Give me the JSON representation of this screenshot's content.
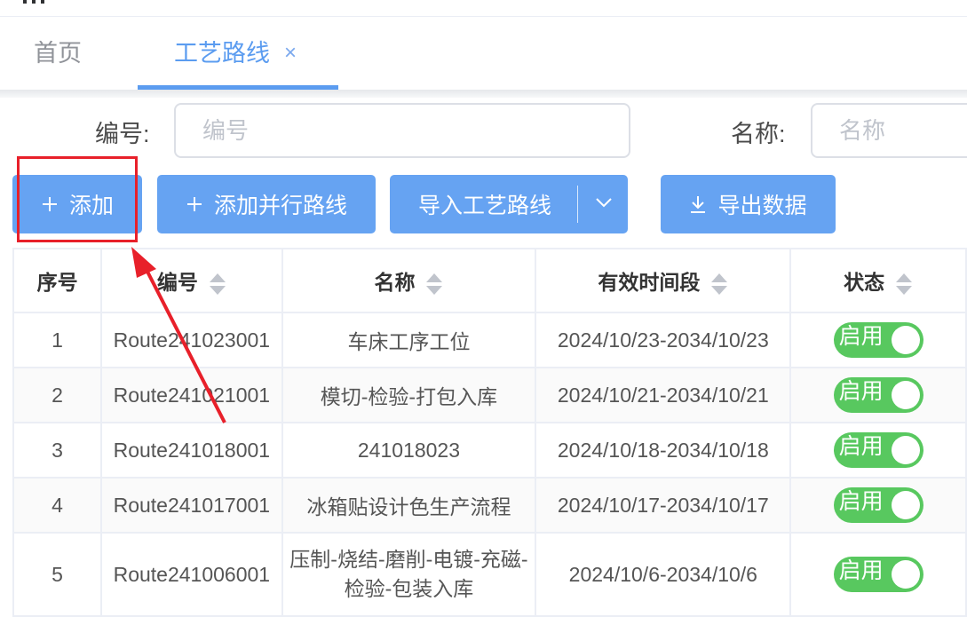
{
  "tabs": {
    "home": "首页",
    "route": "工艺路线",
    "close": "×"
  },
  "search": {
    "code_label": "编号:",
    "code_placeholder": "编号",
    "name_label": "名称:",
    "name_placeholder": "名称"
  },
  "toolbar": {
    "add": "添加",
    "add_parallel": "添加并行路线",
    "import": "导入工艺路线",
    "export": "导出数据"
  },
  "table": {
    "headers": {
      "index": "序号",
      "code": "编号",
      "name": "名称",
      "period": "有效时间段",
      "status": "状态"
    },
    "rows": [
      {
        "index": "1",
        "code": "Route241023001",
        "name": "车床工序工位",
        "period": "2024/10/23-2034/10/23",
        "status": "启用"
      },
      {
        "index": "2",
        "code": "Route241021001",
        "name": "模切-检验-打包入库",
        "period": "2024/10/21-2034/10/21",
        "status": "启用"
      },
      {
        "index": "3",
        "code": "Route241018001",
        "name": "241018023",
        "period": "2024/10/18-2034/10/18",
        "status": "启用"
      },
      {
        "index": "4",
        "code": "Route241017001",
        "name": "冰箱贴设计色生产流程",
        "period": "2024/10/17-2034/10/17",
        "status": "启用"
      },
      {
        "index": "5",
        "code": "Route241006001",
        "name_line1": "压制-烧结-磨削-电镀-充磁-",
        "name_line2": "检验-包装入库",
        "period": "2024/10/6-2034/10/6",
        "status": "启用"
      }
    ]
  },
  "colors": {
    "primary": "#5b9cf0",
    "button": "#66a3f2",
    "switch_on": "#58c85f",
    "annotation": "#e8202a"
  },
  "icons": [
    "plus-icon",
    "download-icon",
    "chevron-down-icon",
    "sort-icon",
    "close-icon"
  ]
}
